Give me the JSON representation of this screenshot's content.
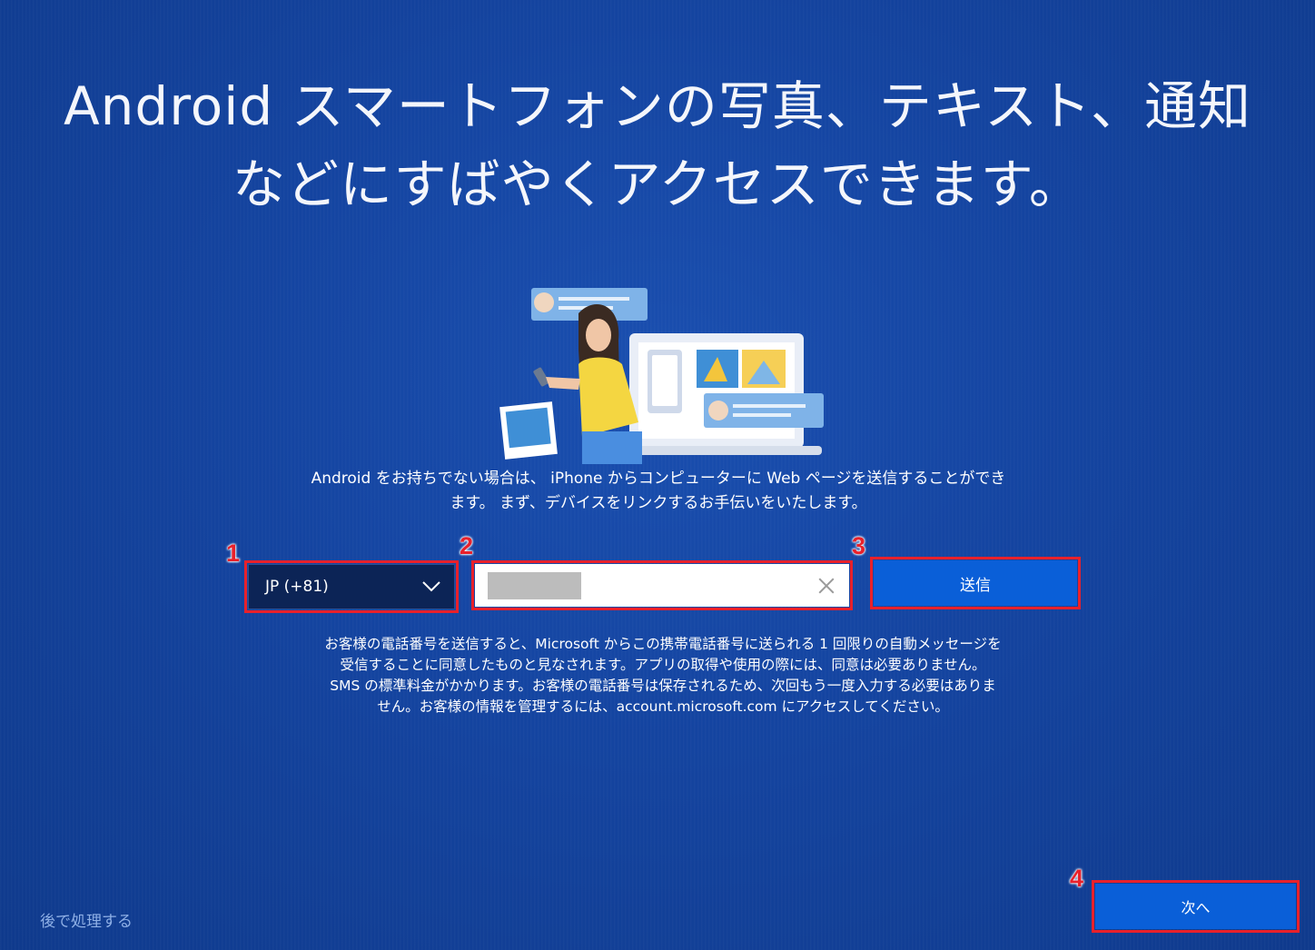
{
  "headline": {
    "line1": "Android スマートフォンの写真、テキスト、通知",
    "line2": "などにすばやくアクセスできます。"
  },
  "description": {
    "line1": "Android をお持ちでない場合は、 iPhone からコンピューターに Web ページを送信することができ",
    "line2": "ます。 まず、デバイスをリンクするお手伝いをいたします。"
  },
  "country_select": {
    "value": "JP (+81)",
    "icon": "chevron-down-icon"
  },
  "phone_input": {
    "value": "",
    "clear_icon": "close-icon"
  },
  "send_button": {
    "label": "送信"
  },
  "consent": {
    "line1": "お客様の電話番号を送信すると、Microsoft からこの携帯電話番号に送られる 1 回限りの自動メッセージを",
    "line2": "受信することに同意したものと見なされます。アプリの取得や使用の際には、同意は必要ありません。",
    "line3": "SMS の標準料金がかかります。お客様の電話番号は保存されるため、次回もう一度入力する必要はありま",
    "line4": "せん。お客様の情報を管理するには、account.microsoft.com にアクセスしてください。"
  },
  "later_link": "後で処理する",
  "next_button": {
    "label": "次へ"
  },
  "annotations": [
    "1",
    "2",
    "3",
    "4"
  ],
  "colors": {
    "background": "#1444a0",
    "button": "#0a5fd8",
    "highlight": "#e8212b"
  }
}
